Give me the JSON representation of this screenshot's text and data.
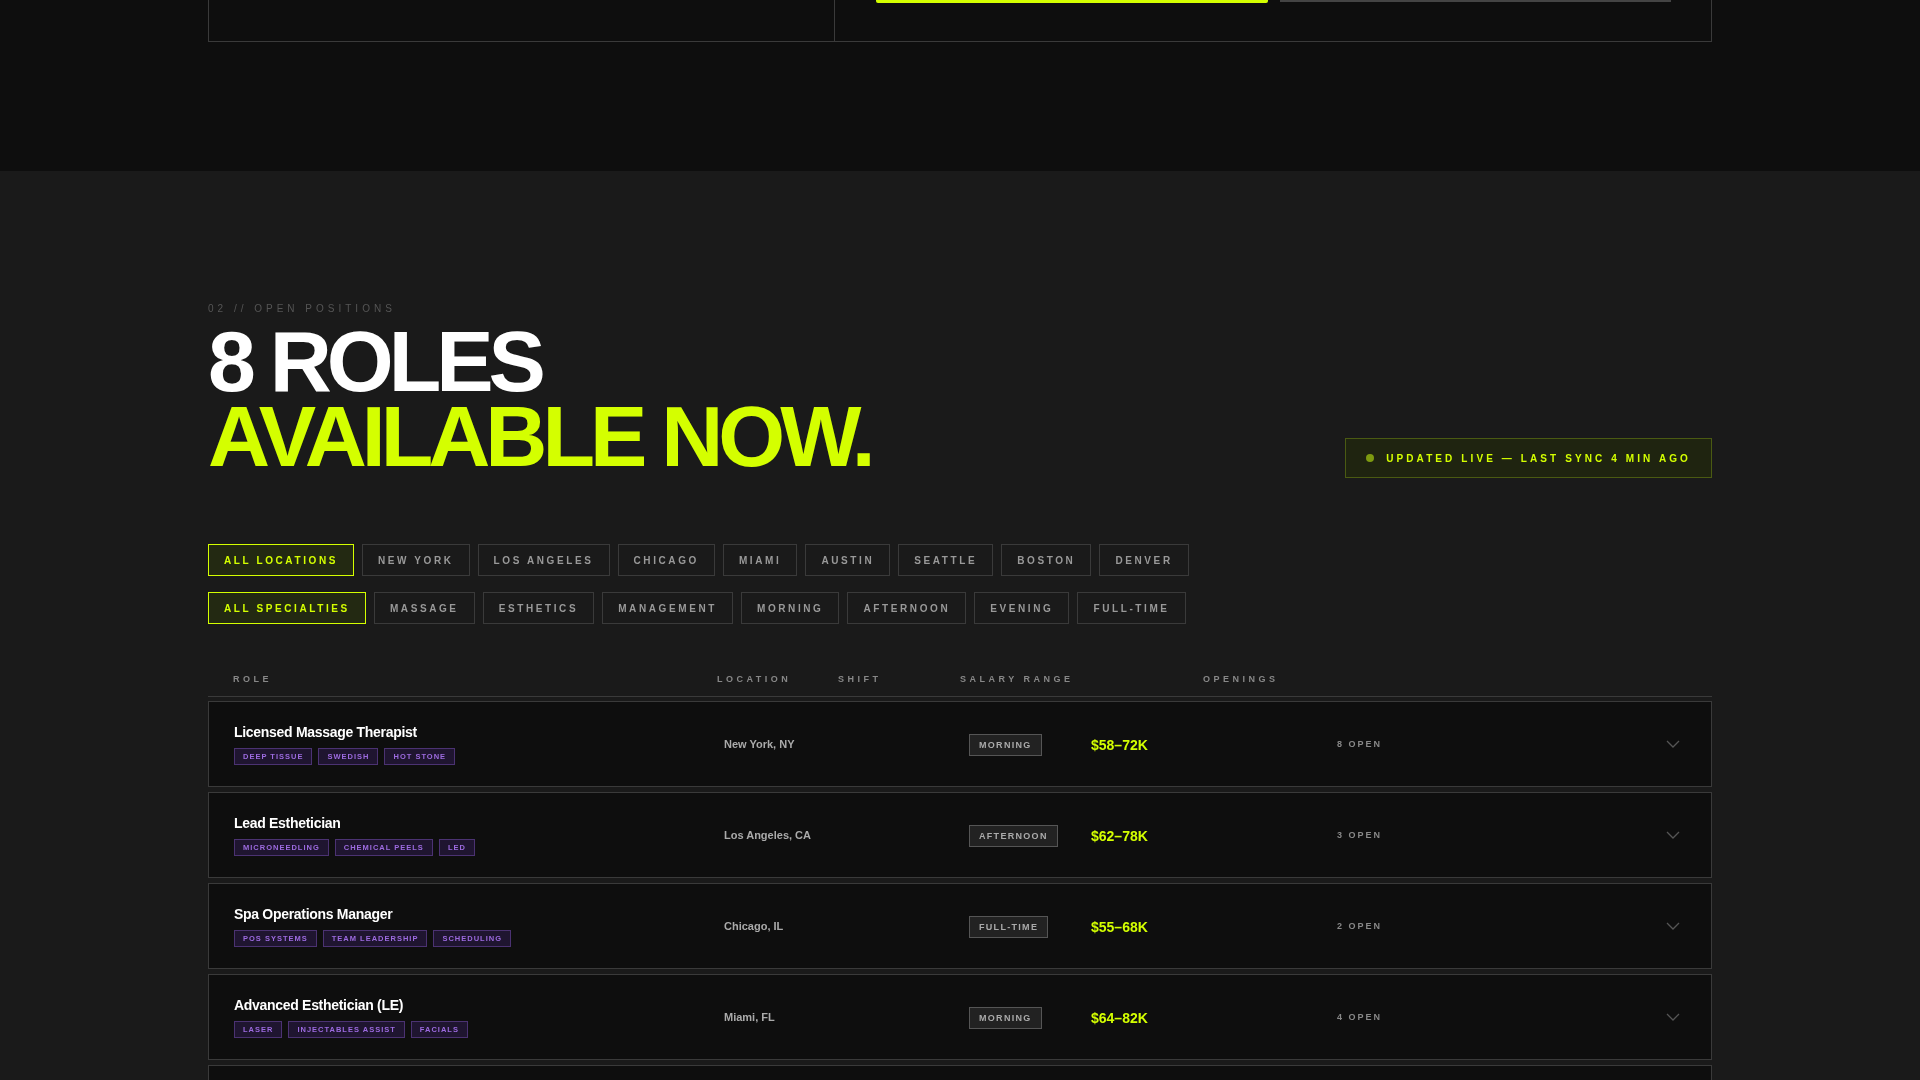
{
  "top_panel": {
    "steps": [
      {
        "active": true
      },
      {
        "active": false
      }
    ]
  },
  "section": {
    "eyebrow": "02 // OPEN POSITIONS",
    "title_line_1": "8 ROLES",
    "title_line_2": "AVAILABLE NOW.",
    "live_badge": "UPDATED LIVE — LAST SYNC 4 MIN AGO"
  },
  "location_filters": [
    {
      "label": "ALL LOCATIONS",
      "selected": true
    },
    {
      "label": "NEW YORK",
      "selected": false
    },
    {
      "label": "LOS ANGELES",
      "selected": false
    },
    {
      "label": "CHICAGO",
      "selected": false
    },
    {
      "label": "MIAMI",
      "selected": false
    },
    {
      "label": "AUSTIN",
      "selected": false
    },
    {
      "label": "SEATTLE",
      "selected": false
    },
    {
      "label": "BOSTON",
      "selected": false
    },
    {
      "label": "DENVER",
      "selected": false
    }
  ],
  "specialty_filters": [
    {
      "label": "ALL SPECIALTIES",
      "selected": true
    },
    {
      "label": "MASSAGE",
      "selected": false
    },
    {
      "label": "ESTHETICS",
      "selected": false
    },
    {
      "label": "MANAGEMENT",
      "selected": false
    },
    {
      "label": "MORNING",
      "selected": false
    },
    {
      "label": "AFTERNOON",
      "selected": false
    },
    {
      "label": "EVENING",
      "selected": false
    },
    {
      "label": "FULL-TIME",
      "selected": false
    }
  ],
  "table": {
    "columns": [
      "ROLE",
      "LOCATION",
      "SHIFT",
      "SALARY RANGE",
      "OPENINGS"
    ],
    "rows": [
      {
        "role": "Licensed Massage Therapist",
        "tags": [
          "DEEP TISSUE",
          "SWEDISH",
          "HOT STONE"
        ],
        "location": "New York, NY",
        "shift": "MORNING",
        "salary": "$58–72K",
        "openings": "8 OPEN"
      },
      {
        "role": "Lead Esthetician",
        "tags": [
          "MICRONEEDLING",
          "CHEMICAL PEELS",
          "LED"
        ],
        "location": "Los Angeles, CA",
        "shift": "AFTERNOON",
        "salary": "$62–78K",
        "openings": "3 OPEN"
      },
      {
        "role": "Spa Operations Manager",
        "tags": [
          "POS SYSTEMS",
          "TEAM LEADERSHIP",
          "SCHEDULING"
        ],
        "location": "Chicago, IL",
        "shift": "FULL-TIME",
        "salary": "$55–68K",
        "openings": "2 OPEN"
      },
      {
        "role": "Advanced Esthetician (LE)",
        "tags": [
          "LASER",
          "INJECTABLES ASSIST",
          "FACIALS"
        ],
        "location": "Miami, FL",
        "shift": "MORNING",
        "salary": "$64–82K",
        "openings": "4 OPEN"
      }
    ]
  }
}
